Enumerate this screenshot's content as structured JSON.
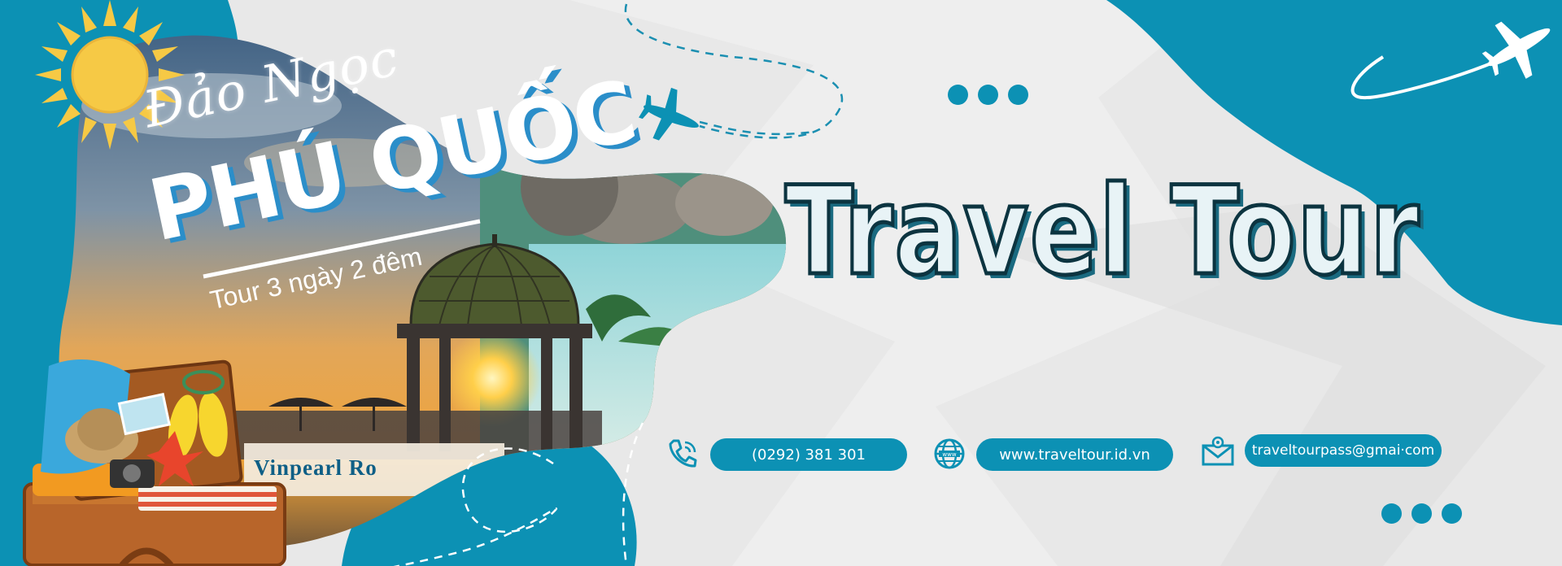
{
  "banner": {
    "script_title": "Đảo Ngọc",
    "big_title": "PHÚ QUỐC",
    "subtitle": "Tour 3 ngày 2 đêm",
    "resort_label": "Vinpearl Ro",
    "heading": "Travel Tour"
  },
  "contacts": {
    "phone": "(0292) 381 301",
    "website": "www.traveltour.id.vn",
    "email": "traveltourpass@gmai·com"
  },
  "icons": {
    "sun": "sun-icon",
    "plane_small": "airplane-icon",
    "plane_top": "airplane-icon",
    "phone": "phone-icon",
    "globe": "globe-icon",
    "mail": "mail-icon"
  },
  "colors": {
    "teal": "#0c91b4",
    "paper": "#e9e9e9",
    "heading_outline": "#0c3440",
    "sun": "#f6c945"
  }
}
